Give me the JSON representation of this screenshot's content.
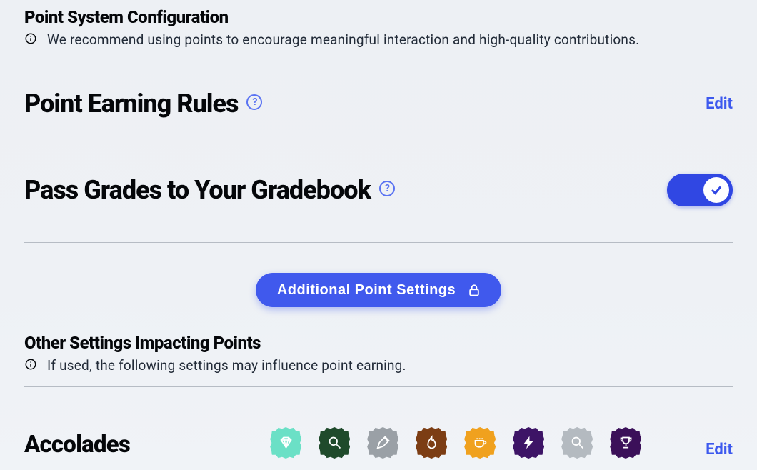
{
  "pointSystem": {
    "title": "Point System Configuration",
    "info": "We recommend using points to encourage meaningful interaction and high-quality contributions."
  },
  "earningRules": {
    "title": "Point Earning Rules",
    "editLabel": "Edit"
  },
  "passGrades": {
    "title": "Pass Grades to Your Gradebook",
    "enabled": true
  },
  "additionalBtn": {
    "label": "Additional Point Settings"
  },
  "otherSettings": {
    "title": "Other Settings Impacting Points",
    "info": "If used, the following settings may influence point earning."
  },
  "accolades": {
    "title": "Accolades",
    "editLabel": "Edit",
    "badges": [
      {
        "name": "diamond-badge",
        "color": "teal"
      },
      {
        "name": "search-badge",
        "color": "dgreen"
      },
      {
        "name": "pen-badge",
        "color": "gray"
      },
      {
        "name": "flame-badge",
        "color": "brown"
      },
      {
        "name": "coffee-badge",
        "color": "orange"
      },
      {
        "name": "bolt-badge",
        "color": "purple"
      },
      {
        "name": "magnifier-badge",
        "color": "silver"
      },
      {
        "name": "trophy-badge",
        "color": "dpurp"
      }
    ]
  },
  "helpGlyph": "?"
}
